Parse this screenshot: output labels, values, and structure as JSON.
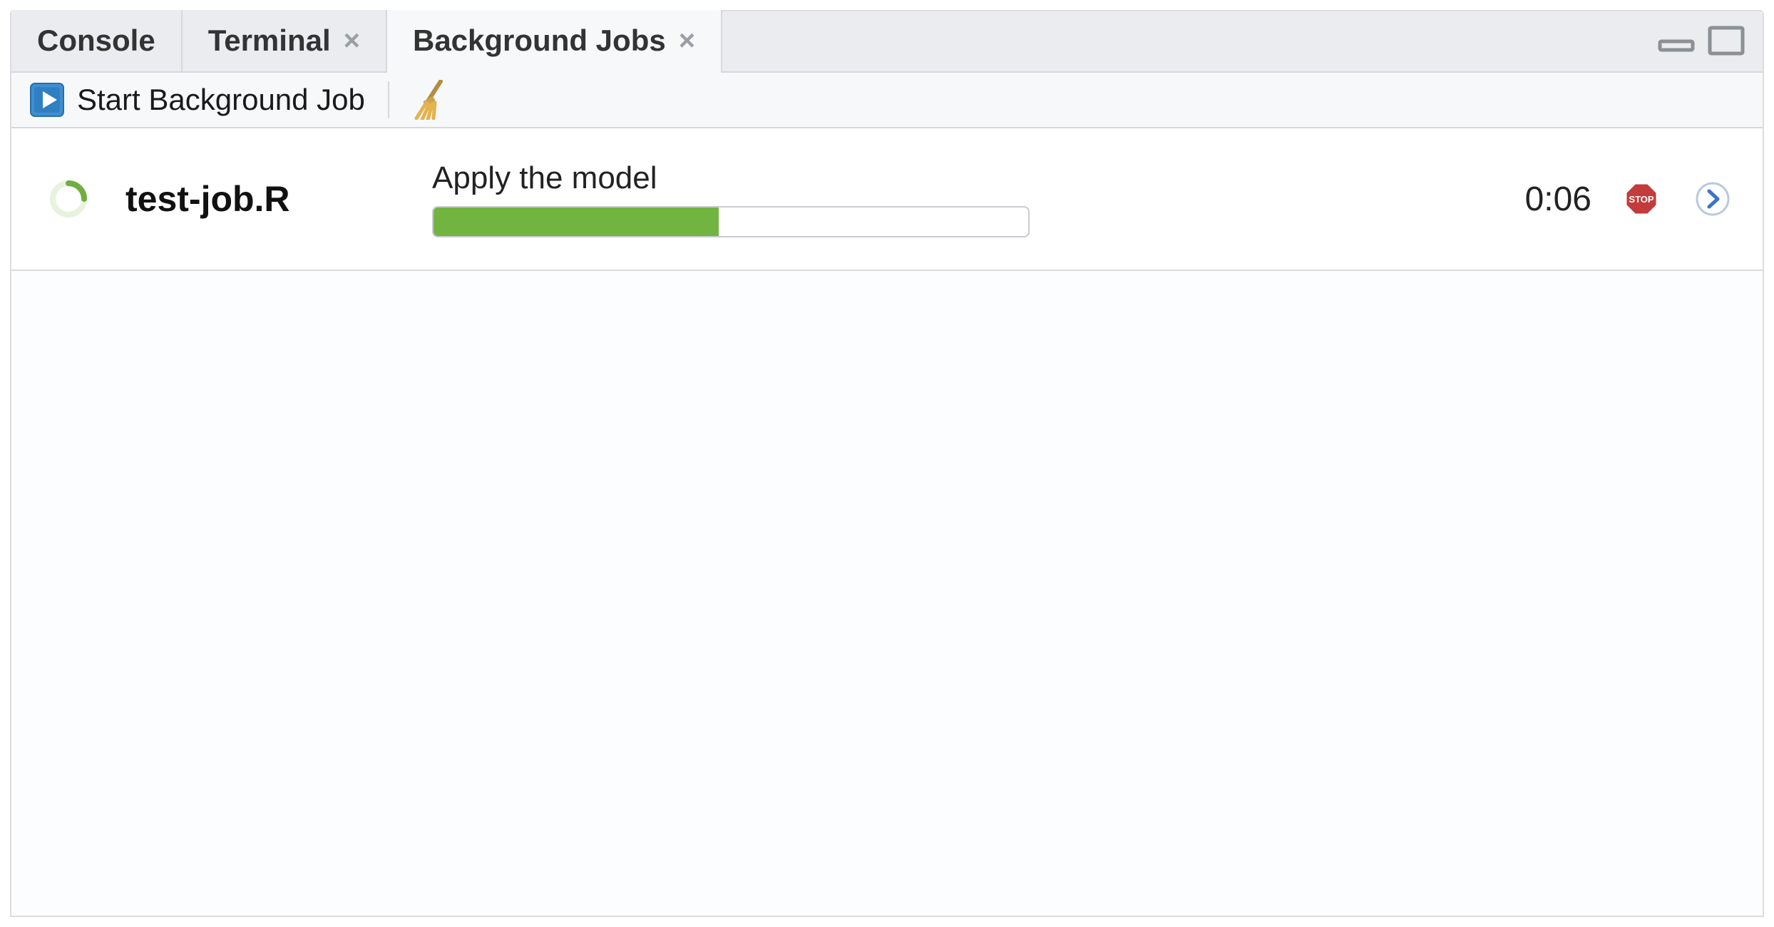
{
  "tabs": [
    {
      "label": "Console",
      "closable": false,
      "active": false
    },
    {
      "label": "Terminal",
      "closable": true,
      "active": false
    },
    {
      "label": "Background Jobs",
      "closable": true,
      "active": true
    }
  ],
  "tabbar_icons": {
    "minimize": "minimize-icon",
    "maximize": "maximize-icon"
  },
  "toolbar": {
    "start_label": "Start Background Job",
    "clear_icon": "broom-icon",
    "play_icon": "play-icon"
  },
  "jobs": [
    {
      "name": "test-job.R",
      "status_text": "Apply the model",
      "progress_percent": 48,
      "elapsed": "0:06",
      "spinner_icon": "spinner-icon",
      "stop_icon": "stop-icon",
      "open_icon": "chevron-right-icon"
    }
  ],
  "colors": {
    "progress_fill": "#72b440",
    "tab_bg": "#eaecef",
    "tool_bg": "#f6f8fa",
    "border": "#d6d8da"
  }
}
